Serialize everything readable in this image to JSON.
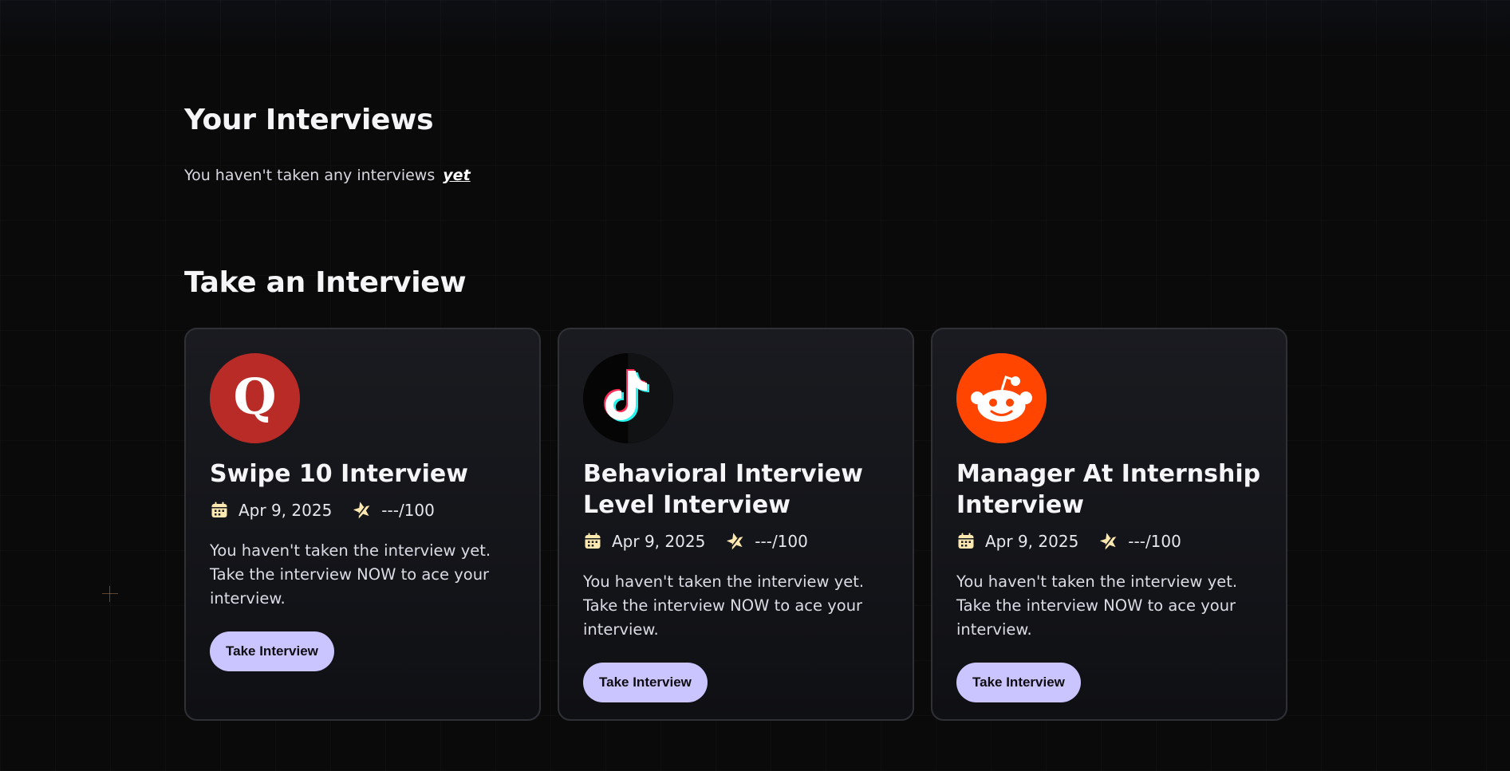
{
  "your_interviews": {
    "title": "Your Interviews",
    "empty_text": "You haven't taken any interviews",
    "empty_emphasis": "yet"
  },
  "take_interview": {
    "title": "Take an Interview",
    "cards": [
      {
        "logo": "quora-logo-icon",
        "title": "Swipe 10 Interview",
        "date": "Apr 9, 2025",
        "score": "---/100",
        "description": "You haven't taken the interview yet. Take the interview NOW to ace your interview.",
        "button_label": "Take Interview"
      },
      {
        "logo": "tiktok-logo-icon",
        "title": "Behavioral Interview Level Interview",
        "date": "Apr 9, 2025",
        "score": "---/100",
        "description": "You haven't taken the interview yet. Take the interview NOW to ace your interview.",
        "button_label": "Take Interview"
      },
      {
        "logo": "reddit-logo-icon",
        "title": "Manager At Internship Interview",
        "date": "Apr 9, 2025",
        "score": "---/100",
        "description": "You haven't taken the interview yet. Take the interview NOW to ace your interview.",
        "button_label": "Take Interview"
      }
    ]
  },
  "colors": {
    "background": "#0a0a0b",
    "card_border": "#2f3137",
    "button_bg": "#cac5fe",
    "icon_accent": "#fde8b0",
    "quora_red": "#b92b27",
    "reddit_orange": "#ff4500"
  }
}
